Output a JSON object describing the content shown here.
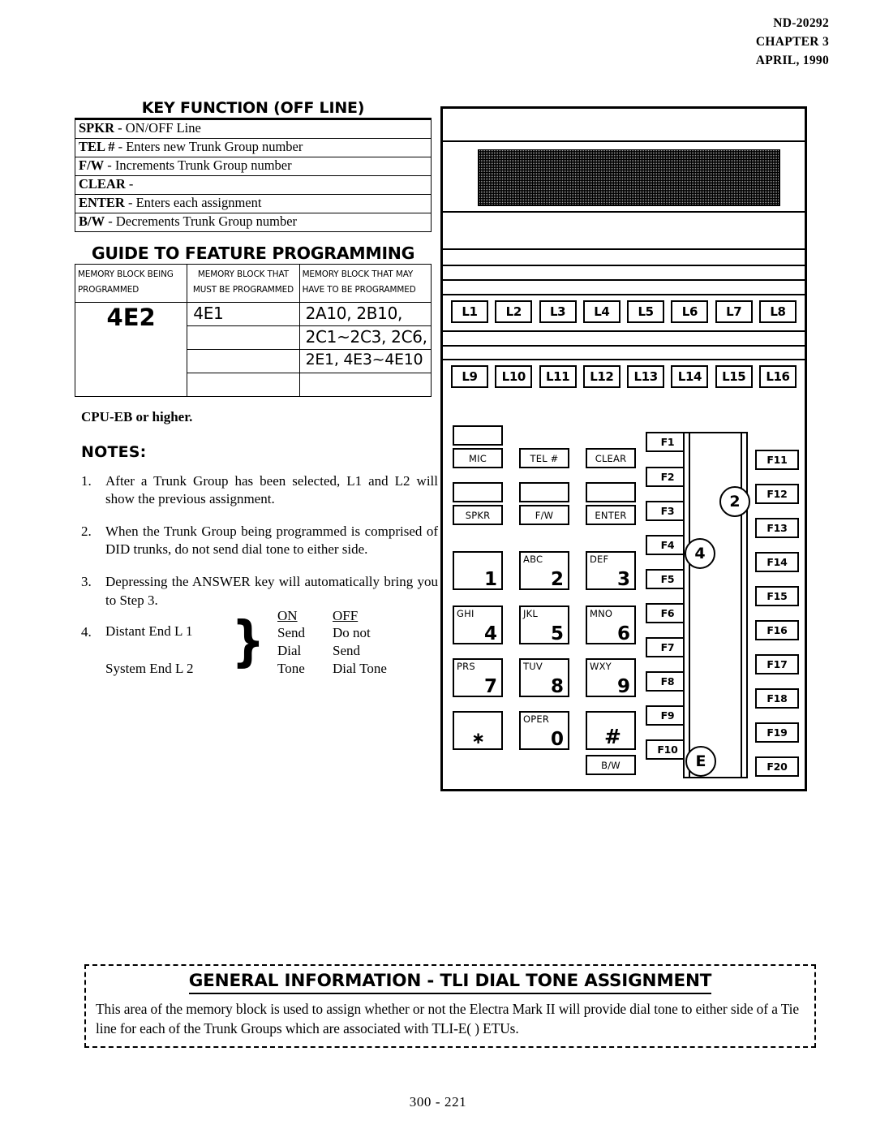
{
  "header": {
    "doc_number": "ND-20292",
    "chapter": "CHAPTER 3",
    "date": "APRIL, 1990"
  },
  "key_function": {
    "title": "KEY FUNCTION (OFF LINE)",
    "rows": [
      {
        "key": "SPKR",
        "desc": "- ON/OFF Line"
      },
      {
        "key": "TEL #",
        "desc": "- Enters new Trunk Group number"
      },
      {
        "key": "F/W",
        "desc": "-  Increments Trunk Group number"
      },
      {
        "key": "CLEAR",
        "desc": "-"
      },
      {
        "key": "ENTER",
        "desc": "- Enters each assignment"
      },
      {
        "key": "B/W",
        "desc": "-  Decrements Trunk Group  number"
      }
    ]
  },
  "guide": {
    "title": "GUIDE TO FEATURE PROGRAMMING",
    "headers": {
      "col1_line1": "MEMORY BLOCK BEING",
      "col1_line2": "PROGRAMMED",
      "col2_line1": "MEMORY BLOCK THAT",
      "col2_line2": "MUST BE PROGRAMMED",
      "col3_line1": "MEMORY BLOCK THAT MAY",
      "col3_line2": "HAVE TO BE PROGRAMMED"
    },
    "being_programmed": "4E2",
    "must_be_programmed": [
      "4E1",
      "",
      "",
      ""
    ],
    "may_have_to_be_programmed": [
      "2A10, 2B10,",
      "2C1~2C3, 2C6,",
      "2E1,  4E3~4E10",
      ""
    ]
  },
  "cpu_note": "CPU-EB or higher.",
  "notes": {
    "heading": "NOTES:",
    "items": [
      {
        "num": "1.",
        "text": "After a Trunk Group has been selected, L1 and L2 will show the previous assignment."
      },
      {
        "num": "2.",
        "text": "When the Trunk Group being programmed is comprised of DID trunks, do not send dial tone to either side."
      },
      {
        "num": "3.",
        "text": "Depressing the ANSWER key will automatically bring you to Step 3."
      }
    ],
    "note4": {
      "num": "4.",
      "line1": "Distant End L 1",
      "line2": "System End L 2",
      "columns": [
        {
          "header": "ON",
          "lines": [
            "Send",
            "Dial",
            "Tone"
          ]
        },
        {
          "header": "OFF",
          "lines": [
            "Do not",
            "Send",
            "Dial Tone"
          ]
        }
      ]
    }
  },
  "phone": {
    "line_keys_row1": [
      "L1",
      "L2",
      "L3",
      "L4",
      "L5",
      "L6",
      "L7",
      "L8"
    ],
    "line_keys_row2": [
      "L9",
      "L10",
      "L11",
      "L12",
      "L13",
      "L14",
      "L15",
      "L16"
    ],
    "function_keys_left": [
      "F1",
      "F2",
      "F3",
      "F4",
      "F5",
      "F6",
      "F7",
      "F8",
      "F9",
      "F10"
    ],
    "function_keys_right": [
      "F11",
      "F12",
      "F13",
      "F14",
      "F15",
      "F16",
      "F17",
      "F18",
      "F19",
      "F20"
    ],
    "feature_keys": [
      "MIC",
      "TEL #",
      "CLEAR",
      "SPKR",
      "F/W",
      "ENTER"
    ],
    "bw_key": "B/W",
    "keypad": [
      {
        "letters": "",
        "digit": "1"
      },
      {
        "letters": "ABC",
        "digit": "2"
      },
      {
        "letters": "DEF",
        "digit": "3"
      },
      {
        "letters": "GHI",
        "digit": "4"
      },
      {
        "letters": "JKL",
        "digit": "5"
      },
      {
        "letters": "MNO",
        "digit": "6"
      },
      {
        "letters": "PRS",
        "digit": "7"
      },
      {
        "letters": "TUV",
        "digit": "8"
      },
      {
        "letters": "WXY",
        "digit": "9"
      },
      {
        "letters": "",
        "digit": "∗"
      },
      {
        "letters": "OPER",
        "digit": "0"
      },
      {
        "letters": "",
        "digit": "#"
      }
    ],
    "markers": [
      "2",
      "4",
      "E"
    ]
  },
  "general_info": {
    "title": "GENERAL INFORMATION - TLI DIAL TONE  ASSIGNMENT",
    "body": "This area of the memory block is used to assign whether or not the Electra Mark II will provide dial tone to either side of a Tie line for each of the Trunk Groups which are associated with TLI-E( ) ETUs."
  },
  "footer": "300 - 221"
}
